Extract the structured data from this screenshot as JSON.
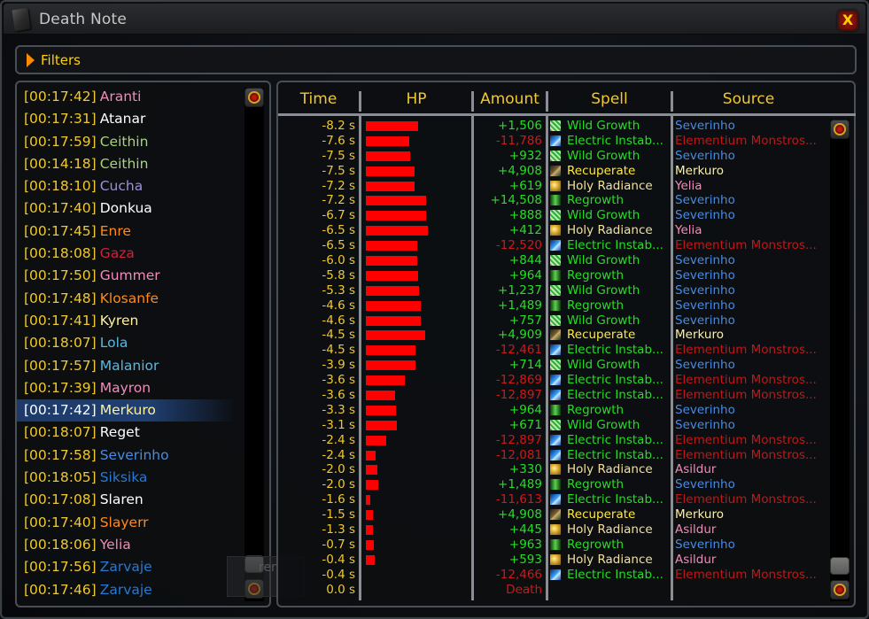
{
  "window": {
    "title": "Death Note",
    "close_label": "X"
  },
  "filters": {
    "label": "Filters"
  },
  "colors": {
    "timestamp": "#f0c830",
    "heal": "#28dc28",
    "damage": "#d01818",
    "spell_green": "#28dc28",
    "spell_yellow": "#ffe840",
    "spell_tan": "#f0e0a0",
    "hp_bar": "#ff0000",
    "selected_row": "#1f3f72"
  },
  "deaths": [
    {
      "time": "[00:17:42]",
      "name": "Aranti",
      "color": "#f08cba"
    },
    {
      "time": "[00:17:31]",
      "name": "Atanar",
      "color": "#ffffff"
    },
    {
      "time": "[00:17:59]",
      "name": "Ceithin",
      "color": "#a8d478"
    },
    {
      "time": "[00:14:18]",
      "name": "Ceithin",
      "color": "#a8d478"
    },
    {
      "time": "[00:18:10]",
      "name": "Cucha",
      "color": "#9a90dc"
    },
    {
      "time": "[00:17:40]",
      "name": "Donkua",
      "color": "#ffffff"
    },
    {
      "time": "[00:17:45]",
      "name": "Enre",
      "color": "#ff8a1a"
    },
    {
      "time": "[00:18:08]",
      "name": "Gaza",
      "color": "#d0203a"
    },
    {
      "time": "[00:17:50]",
      "name": "Gummer",
      "color": "#f08cba"
    },
    {
      "time": "[00:17:48]",
      "name": "Klosanfe",
      "color": "#ff8a1a"
    },
    {
      "time": "[00:17:41]",
      "name": "Kyren",
      "color": "#fff0a0"
    },
    {
      "time": "[00:18:07]",
      "name": "Lola",
      "color": "#5ab8e0"
    },
    {
      "time": "[00:17:57]",
      "name": "Malanior",
      "color": "#5ab8e0"
    },
    {
      "time": "[00:17:39]",
      "name": "Mayron",
      "color": "#f08cba"
    },
    {
      "time": "[00:17:42]",
      "name": "Merkuro",
      "color": "#fff0a0",
      "selected": true
    },
    {
      "time": "[00:18:07]",
      "name": "Reget",
      "color": "#ffffff"
    },
    {
      "time": "[00:17:58]",
      "name": "Severinho",
      "color": "#4a8ae0"
    },
    {
      "time": "[00:18:05]",
      "name": "Siksika",
      "color": "#2a78d0"
    },
    {
      "time": "[00:17:08]",
      "name": "Slaren",
      "color": "#ffffff"
    },
    {
      "time": "[00:17:40]",
      "name": "Slayerr",
      "color": "#ff8a1a"
    },
    {
      "time": "[00:18:06]",
      "name": "Yelia",
      "color": "#f08cba"
    },
    {
      "time": "[00:17:56]",
      "name": "Zarvaje",
      "color": "#2a78d0"
    },
    {
      "time": "[00:17:46]",
      "name": "Zarvaje",
      "color": "#2a78d0"
    }
  ],
  "ghost_text": "ren",
  "table": {
    "headers": {
      "time": "Time",
      "hp": "HP",
      "amount": "Amount",
      "spell": "Spell",
      "source": "Source"
    },
    "rows": [
      {
        "time": "-8.2 s",
        "hp_pct": 52,
        "amount": "+1,506",
        "type": "heal",
        "icon": "wild-growth",
        "spell": "Wild Growth",
        "spell_color": "green",
        "source": "Severinho",
        "source_color": "#4a8ae0"
      },
      {
        "time": "-7.6 s",
        "hp_pct": 43,
        "amount": "-11,786",
        "type": "damage",
        "icon": "electric-instability",
        "spell": "Electric Instab...",
        "spell_color": "green",
        "source": "Elementium Monstros...",
        "source_color": "#c01818"
      },
      {
        "time": "-7.5 s",
        "hp_pct": 44,
        "amount": "+932",
        "type": "heal",
        "icon": "wild-growth",
        "spell": "Wild Growth",
        "spell_color": "green",
        "source": "Severinho",
        "source_color": "#4a8ae0"
      },
      {
        "time": "-7.5 s",
        "hp_pct": 48,
        "amount": "+4,908",
        "type": "heal",
        "icon": "recuperate",
        "spell": "Recuperate",
        "spell_color": "yellow",
        "source": "Merkuro",
        "source_color": "#fff0a0"
      },
      {
        "time": "-7.2 s",
        "hp_pct": 48,
        "amount": "+619",
        "type": "heal",
        "icon": "holy-radiance",
        "spell": "Holy Radiance",
        "spell_color": "tan",
        "source": "Yelia",
        "source_color": "#f08cba"
      },
      {
        "time": "-7.2 s",
        "hp_pct": 60,
        "amount": "+14,508",
        "type": "heal",
        "icon": "regrowth",
        "spell": "Regrowth",
        "spell_color": "green",
        "source": "Severinho",
        "source_color": "#4a8ae0"
      },
      {
        "time": "-6.7 s",
        "hp_pct": 60,
        "amount": "+888",
        "type": "heal",
        "icon": "wild-growth",
        "spell": "Wild Growth",
        "spell_color": "green",
        "source": "Severinho",
        "source_color": "#4a8ae0"
      },
      {
        "time": "-6.5 s",
        "hp_pct": 61,
        "amount": "+412",
        "type": "heal",
        "icon": "holy-radiance",
        "spell": "Holy Radiance",
        "spell_color": "tan",
        "source": "Yelia",
        "source_color": "#f08cba"
      },
      {
        "time": "-6.5 s",
        "hp_pct": 51,
        "amount": "-12,520",
        "type": "damage",
        "icon": "electric-instability",
        "spell": "Electric Instab...",
        "spell_color": "green",
        "source": "Elementium Monstros...",
        "source_color": "#c01818"
      },
      {
        "time": "-6.0 s",
        "hp_pct": 51,
        "amount": "+844",
        "type": "heal",
        "icon": "wild-growth",
        "spell": "Wild Growth",
        "spell_color": "green",
        "source": "Severinho",
        "source_color": "#4a8ae0"
      },
      {
        "time": "-5.8 s",
        "hp_pct": 52,
        "amount": "+964",
        "type": "heal",
        "icon": "regrowth",
        "spell": "Regrowth",
        "spell_color": "green",
        "source": "Severinho",
        "source_color": "#4a8ae0"
      },
      {
        "time": "-5.3 s",
        "hp_pct": 53,
        "amount": "+1,237",
        "type": "heal",
        "icon": "wild-growth",
        "spell": "Wild Growth",
        "spell_color": "green",
        "source": "Severinho",
        "source_color": "#4a8ae0"
      },
      {
        "time": "-4.6 s",
        "hp_pct": 54,
        "amount": "+1,489",
        "type": "heal",
        "icon": "regrowth",
        "spell": "Regrowth",
        "spell_color": "green",
        "source": "Severinho",
        "source_color": "#4a8ae0"
      },
      {
        "time": "-4.6 s",
        "hp_pct": 54,
        "amount": "+757",
        "type": "heal",
        "icon": "wild-growth",
        "spell": "Wild Growth",
        "spell_color": "green",
        "source": "Severinho",
        "source_color": "#4a8ae0"
      },
      {
        "time": "-4.5 s",
        "hp_pct": 59,
        "amount": "+4,909",
        "type": "heal",
        "icon": "recuperate",
        "spell": "Recuperate",
        "spell_color": "yellow",
        "source": "Merkuro",
        "source_color": "#fff0a0"
      },
      {
        "time": "-4.5 s",
        "hp_pct": 49,
        "amount": "-12,461",
        "type": "damage",
        "icon": "electric-instability",
        "spell": "Electric Instab...",
        "spell_color": "green",
        "source": "Elementium Monstros...",
        "source_color": "#c01818"
      },
      {
        "time": "-3.9 s",
        "hp_pct": 49,
        "amount": "+714",
        "type": "heal",
        "icon": "wild-growth",
        "spell": "Wild Growth",
        "spell_color": "green",
        "source": "Severinho",
        "source_color": "#4a8ae0"
      },
      {
        "time": "-3.6 s",
        "hp_pct": 39,
        "amount": "-12,869",
        "type": "damage",
        "icon": "electric-instability",
        "spell": "Electric Instab...",
        "spell_color": "green",
        "source": "Elementium Monstros...",
        "source_color": "#c01818"
      },
      {
        "time": "-3.6 s",
        "hp_pct": 29,
        "amount": "-12,897",
        "type": "damage",
        "icon": "electric-instability",
        "spell": "Electric Instab...",
        "spell_color": "green",
        "source": "Elementium Monstros...",
        "source_color": "#c01818"
      },
      {
        "time": "-3.3 s",
        "hp_pct": 30,
        "amount": "+964",
        "type": "heal",
        "icon": "regrowth",
        "spell": "Regrowth",
        "spell_color": "green",
        "source": "Severinho",
        "source_color": "#4a8ae0"
      },
      {
        "time": "-3.1 s",
        "hp_pct": 31,
        "amount": "+671",
        "type": "heal",
        "icon": "wild-growth",
        "spell": "Wild Growth",
        "spell_color": "green",
        "source": "Severinho",
        "source_color": "#4a8ae0"
      },
      {
        "time": "-2.4 s",
        "hp_pct": 20,
        "amount": "-12,897",
        "type": "damage",
        "icon": "electric-instability",
        "spell": "Electric Instab...",
        "spell_color": "green",
        "source": "Elementium Monstros...",
        "source_color": "#c01818"
      },
      {
        "time": "-2.4 s",
        "hp_pct": 10,
        "amount": "-12,081",
        "type": "damage",
        "icon": "electric-instability",
        "spell": "Electric Instab...",
        "spell_color": "green",
        "source": "Elementium Monstros...",
        "source_color": "#c01818"
      },
      {
        "time": "-2.0 s",
        "hp_pct": 11,
        "amount": "+330",
        "type": "heal",
        "icon": "holy-radiance",
        "spell": "Holy Radiance",
        "spell_color": "tan",
        "source": "Asildur",
        "source_color": "#f08cba"
      },
      {
        "time": "-2.0 s",
        "hp_pct": 12,
        "amount": "+1,489",
        "type": "heal",
        "icon": "regrowth",
        "spell": "Regrowth",
        "spell_color": "green",
        "source": "Severinho",
        "source_color": "#4a8ae0"
      },
      {
        "time": "-1.6 s",
        "hp_pct": 4,
        "amount": "-11,613",
        "type": "damage",
        "icon": "electric-instability",
        "spell": "Electric Instab...",
        "spell_color": "green",
        "source": "Elementium Monstros...",
        "source_color": "#c01818"
      },
      {
        "time": "-1.5 s",
        "hp_pct": 7,
        "amount": "+4,908",
        "type": "heal",
        "icon": "recuperate",
        "spell": "Recuperate",
        "spell_color": "yellow",
        "source": "Merkuro",
        "source_color": "#fff0a0"
      },
      {
        "time": "-1.3 s",
        "hp_pct": 7,
        "amount": "+445",
        "type": "heal",
        "icon": "holy-radiance",
        "spell": "Holy Radiance",
        "spell_color": "tan",
        "source": "Asildur",
        "source_color": "#f08cba"
      },
      {
        "time": "-0.7 s",
        "hp_pct": 8,
        "amount": "+963",
        "type": "heal",
        "icon": "regrowth",
        "spell": "Regrowth",
        "spell_color": "green",
        "source": "Severinho",
        "source_color": "#4a8ae0"
      },
      {
        "time": "-0.4 s",
        "hp_pct": 9,
        "amount": "+593",
        "type": "heal",
        "icon": "holy-radiance",
        "spell": "Holy Radiance",
        "spell_color": "tan",
        "source": "Asildur",
        "source_color": "#f08cba"
      },
      {
        "time": "-0.4 s",
        "hp_pct": 0,
        "amount": "-12,466",
        "type": "damage",
        "icon": "electric-instability",
        "spell": "Electric Instab...",
        "spell_color": "green",
        "source": "Elementium Monstros...",
        "source_color": "#c01818"
      },
      {
        "time": "0.0 s",
        "hp_pct": 0,
        "amount": "Death",
        "type": "damage",
        "icon": "",
        "spell": "",
        "spell_color": "green",
        "source": "",
        "source_color": "#c01818"
      }
    ]
  }
}
